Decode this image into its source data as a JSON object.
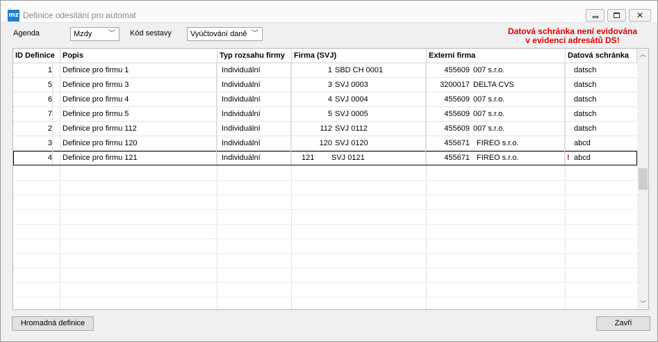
{
  "window": {
    "title": "Definice odesílání pro automat",
    "icon": "mz-app-icon",
    "icon_text": "mz"
  },
  "toolbar": {
    "agenda_label": "Agenda",
    "agenda_value": "Mzdy",
    "kod_label": "Kód sestavy",
    "kod_value": "Vyúčtování daně"
  },
  "warning": {
    "line1": "Datová schránka není evidována",
    "line2": "v evidenci adresátů DS!",
    "color": "#e00000"
  },
  "table": {
    "columns": [
      "ID Definice",
      "Popis",
      "Typ rozsahu firmy",
      "Firma (SVJ)",
      "Externí firma",
      "Datová schránka"
    ],
    "rows": [
      {
        "id": "1",
        "popis": "Definice pro firmu 1",
        "typ": "Individuální",
        "firma_num": "1",
        "firma_name": "SBD CH 0001",
        "ext_num": "455609",
        "ext_name": "007 s.r.o.",
        "flag": "",
        "ds": "datsch"
      },
      {
        "id": "5",
        "popis": "Definice pro firmu 3",
        "typ": "Individuální",
        "firma_num": "3",
        "firma_name": "SVJ 0003",
        "ext_num": "3200017",
        "ext_name": "DELTA CVS",
        "flag": "",
        "ds": "datsch"
      },
      {
        "id": "6",
        "popis": "Definice pro firmu 4",
        "typ": "Individuální",
        "firma_num": "4",
        "firma_name": "SVJ 0004",
        "ext_num": "455609",
        "ext_name": "007 s.r.o.",
        "flag": "",
        "ds": "datsch"
      },
      {
        "id": "7",
        "popis": "Definice pro firmu 5",
        "typ": "Individuální",
        "firma_num": "5",
        "firma_name": "SVJ 0005",
        "ext_num": "455609",
        "ext_name": "007 s.r.o.",
        "flag": "",
        "ds": "datsch"
      },
      {
        "id": "2",
        "popis": "Definice pro firmu 112",
        "typ": "Individuální",
        "firma_num": "112",
        "firma_name": "SVJ 0112",
        "ext_num": "455609",
        "ext_name": "007 s.r.o.",
        "flag": "",
        "ds": "datsch"
      },
      {
        "id": "3",
        "popis": "Definice pro firmu 120",
        "typ": "Individuální",
        "firma_num": "120",
        "firma_name": "SVJ 0120",
        "ext_num": "455671",
        "ext_name": "FIREO  s.r.o.",
        "flag": "",
        "ds": "abcd"
      },
      {
        "id": "4",
        "popis": "Definice pro firmu 121",
        "typ": "Individuální",
        "firma_num": "121",
        "firma_name": "SVJ 0121",
        "ext_num": "455671",
        "ext_name": "FIREO  s.r.o.",
        "flag": "!",
        "ds": "abcd"
      }
    ]
  },
  "buttons": {
    "hromadna": "Hromadná definice",
    "zavri": "Zavři"
  }
}
